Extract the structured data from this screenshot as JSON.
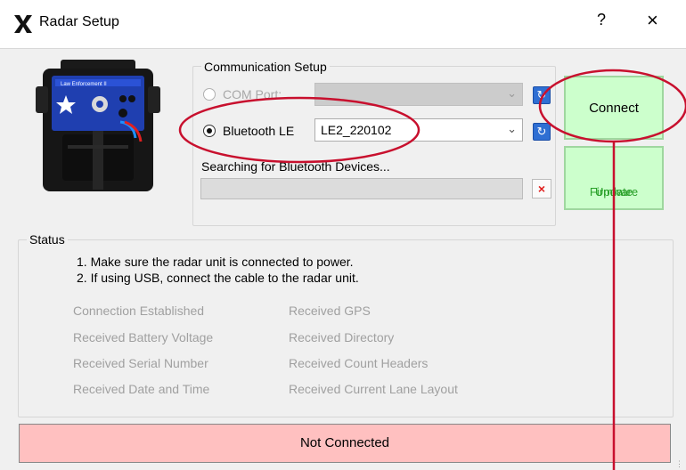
{
  "window": {
    "title": "Radar Setup",
    "help_symbol": "?",
    "close_symbol": "×"
  },
  "communication": {
    "group_label": "Communication Setup",
    "com_port": {
      "label": "COM Port:",
      "selected": false,
      "enabled": false,
      "value": ""
    },
    "bluetooth": {
      "label": "Bluetooth LE",
      "selected": true,
      "enabled": true,
      "value": "LE2_220102"
    },
    "search_status": "Searching for Bluetooth Devices...",
    "progress_fraction": 0.0,
    "cancel_symbol": "×",
    "refresh_symbol": "↻"
  },
  "buttons": {
    "connect": "Connect",
    "update_firmware_line1": "Update",
    "update_firmware_line2": "Firmware"
  },
  "device_image": {
    "label_text": "Law Enforcement II"
  },
  "status": {
    "group_label": "Status",
    "instructions": [
      "1. Make sure the radar unit is connected to power.",
      "2. If using USB, connect the cable to the radar unit."
    ],
    "checks_left": [
      "Connection Established",
      "Received Battery Voltage",
      "Received Serial Number",
      "Received Date and Time"
    ],
    "checks_right": [
      "Received GPS",
      "Received Directory",
      "Received Count Headers",
      "Received Current Lane Layout"
    ],
    "connection_state": "Not Connected"
  },
  "colors": {
    "connect_bg": "#ccffcc",
    "not_connected_bg": "#ffc0c0",
    "annotation_red": "#c8102e"
  }
}
